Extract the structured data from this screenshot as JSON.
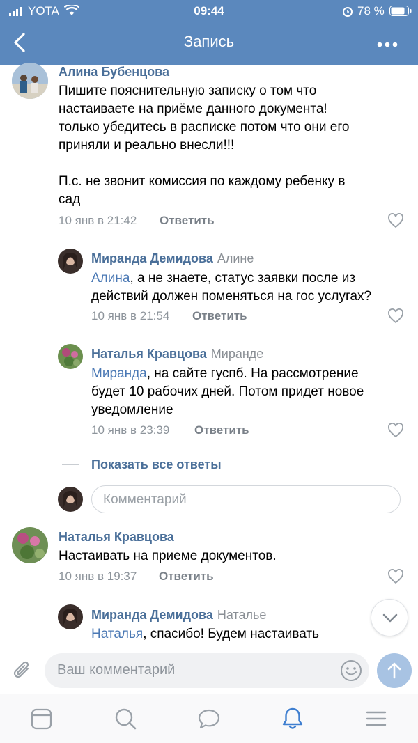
{
  "status_bar": {
    "carrier": "YOTA",
    "time": "09:44",
    "battery": "78 %"
  },
  "nav": {
    "title": "Запись"
  },
  "comments": [
    {
      "author": "Алина Бубенцова",
      "text": "Пишите пояснительную записку о том что\nнастаиваете на приёме данного документа!\nтолько убедитесь в расписке потом что они его\nприняли и реально внесли!!!\n\nП.с. не звонит комиссия по каждому ребенку в\nсад",
      "date": "10 янв в 21:42",
      "reply_label": "Ответить"
    },
    {
      "author": "Миранда Демидова",
      "reply_to": "Алине",
      "mention": "Алина",
      "text": ", а не знаете, статус заявки после из\nдействий должен поменяться на гос услугах?",
      "date": "10 янв в 21:54",
      "reply_label": "Ответить"
    },
    {
      "author": "Наталья Кравцова",
      "reply_to": "Миранде",
      "mention": "Миранда",
      "text": ", на сайте гуспб. На рассмотрение\nбудет 10 рабочих дней. Потом придет новое\nуведомление",
      "date": "10 янв в 23:39",
      "reply_label": "Ответить"
    },
    {
      "author": "Наталья Кравцова",
      "text": "Настаивать на приеме документов.",
      "date": "10 янв в 19:37",
      "reply_label": "Ответить"
    },
    {
      "author": "Миранда Демидова",
      "reply_to": "Наталье",
      "mention": "Наталья",
      "text": ", спасибо! Будем настаивать"
    }
  ],
  "show_all_replies": "Показать все ответы",
  "comment_placeholder": "Комментарий",
  "composer_placeholder": "Ваш комментарий",
  "colors": {
    "header": "#5b88bd",
    "name": "#4a6f99",
    "mention": "#4a78b4",
    "accent": "#3f7fd0"
  },
  "icons": [
    "back-icon",
    "more-icon",
    "heart-icon",
    "attach-icon",
    "emoji-icon",
    "send-icon",
    "chevron-down-icon",
    "news-icon",
    "search-icon",
    "messages-icon",
    "notifications-icon",
    "menu-icon"
  ]
}
